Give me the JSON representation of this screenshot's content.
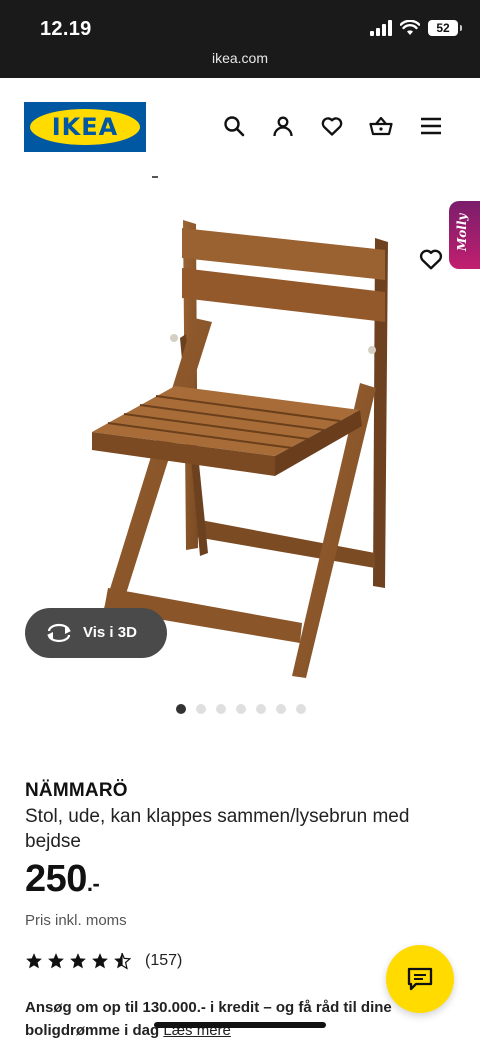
{
  "status_bar": {
    "time": "12.19",
    "url": "ikea.com",
    "battery": "52"
  },
  "header": {
    "logo_text": "IKEA",
    "icons": [
      "search-icon",
      "account-icon",
      "heart-icon",
      "basket-icon",
      "menu-icon"
    ]
  },
  "gallery": {
    "image_alt": "chair",
    "assistant_label": "Molly",
    "view3d_label": "Vis i 3D",
    "dots_total": 7,
    "dots_active": 1
  },
  "product": {
    "name": "NÄMMARÖ",
    "description": "Stol, ude, kan klappes sammen/lysebrun med bejdse",
    "price": "250",
    "price_suffix": ".-",
    "vat_note": "Pris inkl. moms",
    "rating_value": 4.5,
    "rating_count": "(157)",
    "promo_text": "Ansøg om op til 130.000.- i kredit – og få råd til dine boligdrømme i dag",
    "promo_link": "Læs mere"
  },
  "colors": {
    "brand_blue": "#0058a3",
    "brand_yellow": "#ffdb00",
    "molly_pink": "#c21f6f"
  }
}
